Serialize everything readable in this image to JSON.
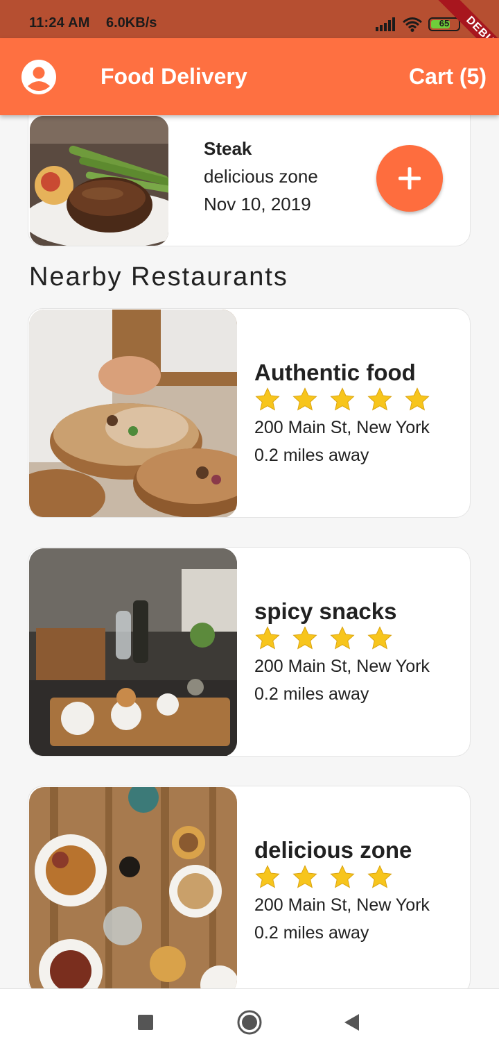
{
  "status_bar": {
    "time": "11:24 AM",
    "speed": "6.0KB/s",
    "battery": "65",
    "debug": "DEBUG"
  },
  "app_bar": {
    "title": "Food Delivery",
    "cart": "Cart (5)",
    "avatar_icon": "account-circle-icon"
  },
  "featured": {
    "name": "Steak",
    "place": "delicious zone",
    "date": "Nov 10, 2019",
    "add_icon": "plus-icon"
  },
  "section_title": "Nearby Restaurants",
  "restaurants": [
    {
      "name": "Authentic food",
      "rating": 5,
      "address": "200 Main St, New York",
      "distance": "0.2 miles away"
    },
    {
      "name": "spicy snacks",
      "rating": 4,
      "address": "200 Main St, New York",
      "distance": "0.2 miles away"
    },
    {
      "name": "delicious zone",
      "rating": 4,
      "address": "200 Main St, New York",
      "distance": "0.2 miles away"
    }
  ],
  "nav_bar": {
    "icons": [
      "recents-square-icon",
      "home-circle-icon",
      "back-triangle-icon"
    ]
  },
  "colors": {
    "accent": "#fe7041",
    "status_bar": "#b64f31",
    "star": "#f7c51c"
  }
}
